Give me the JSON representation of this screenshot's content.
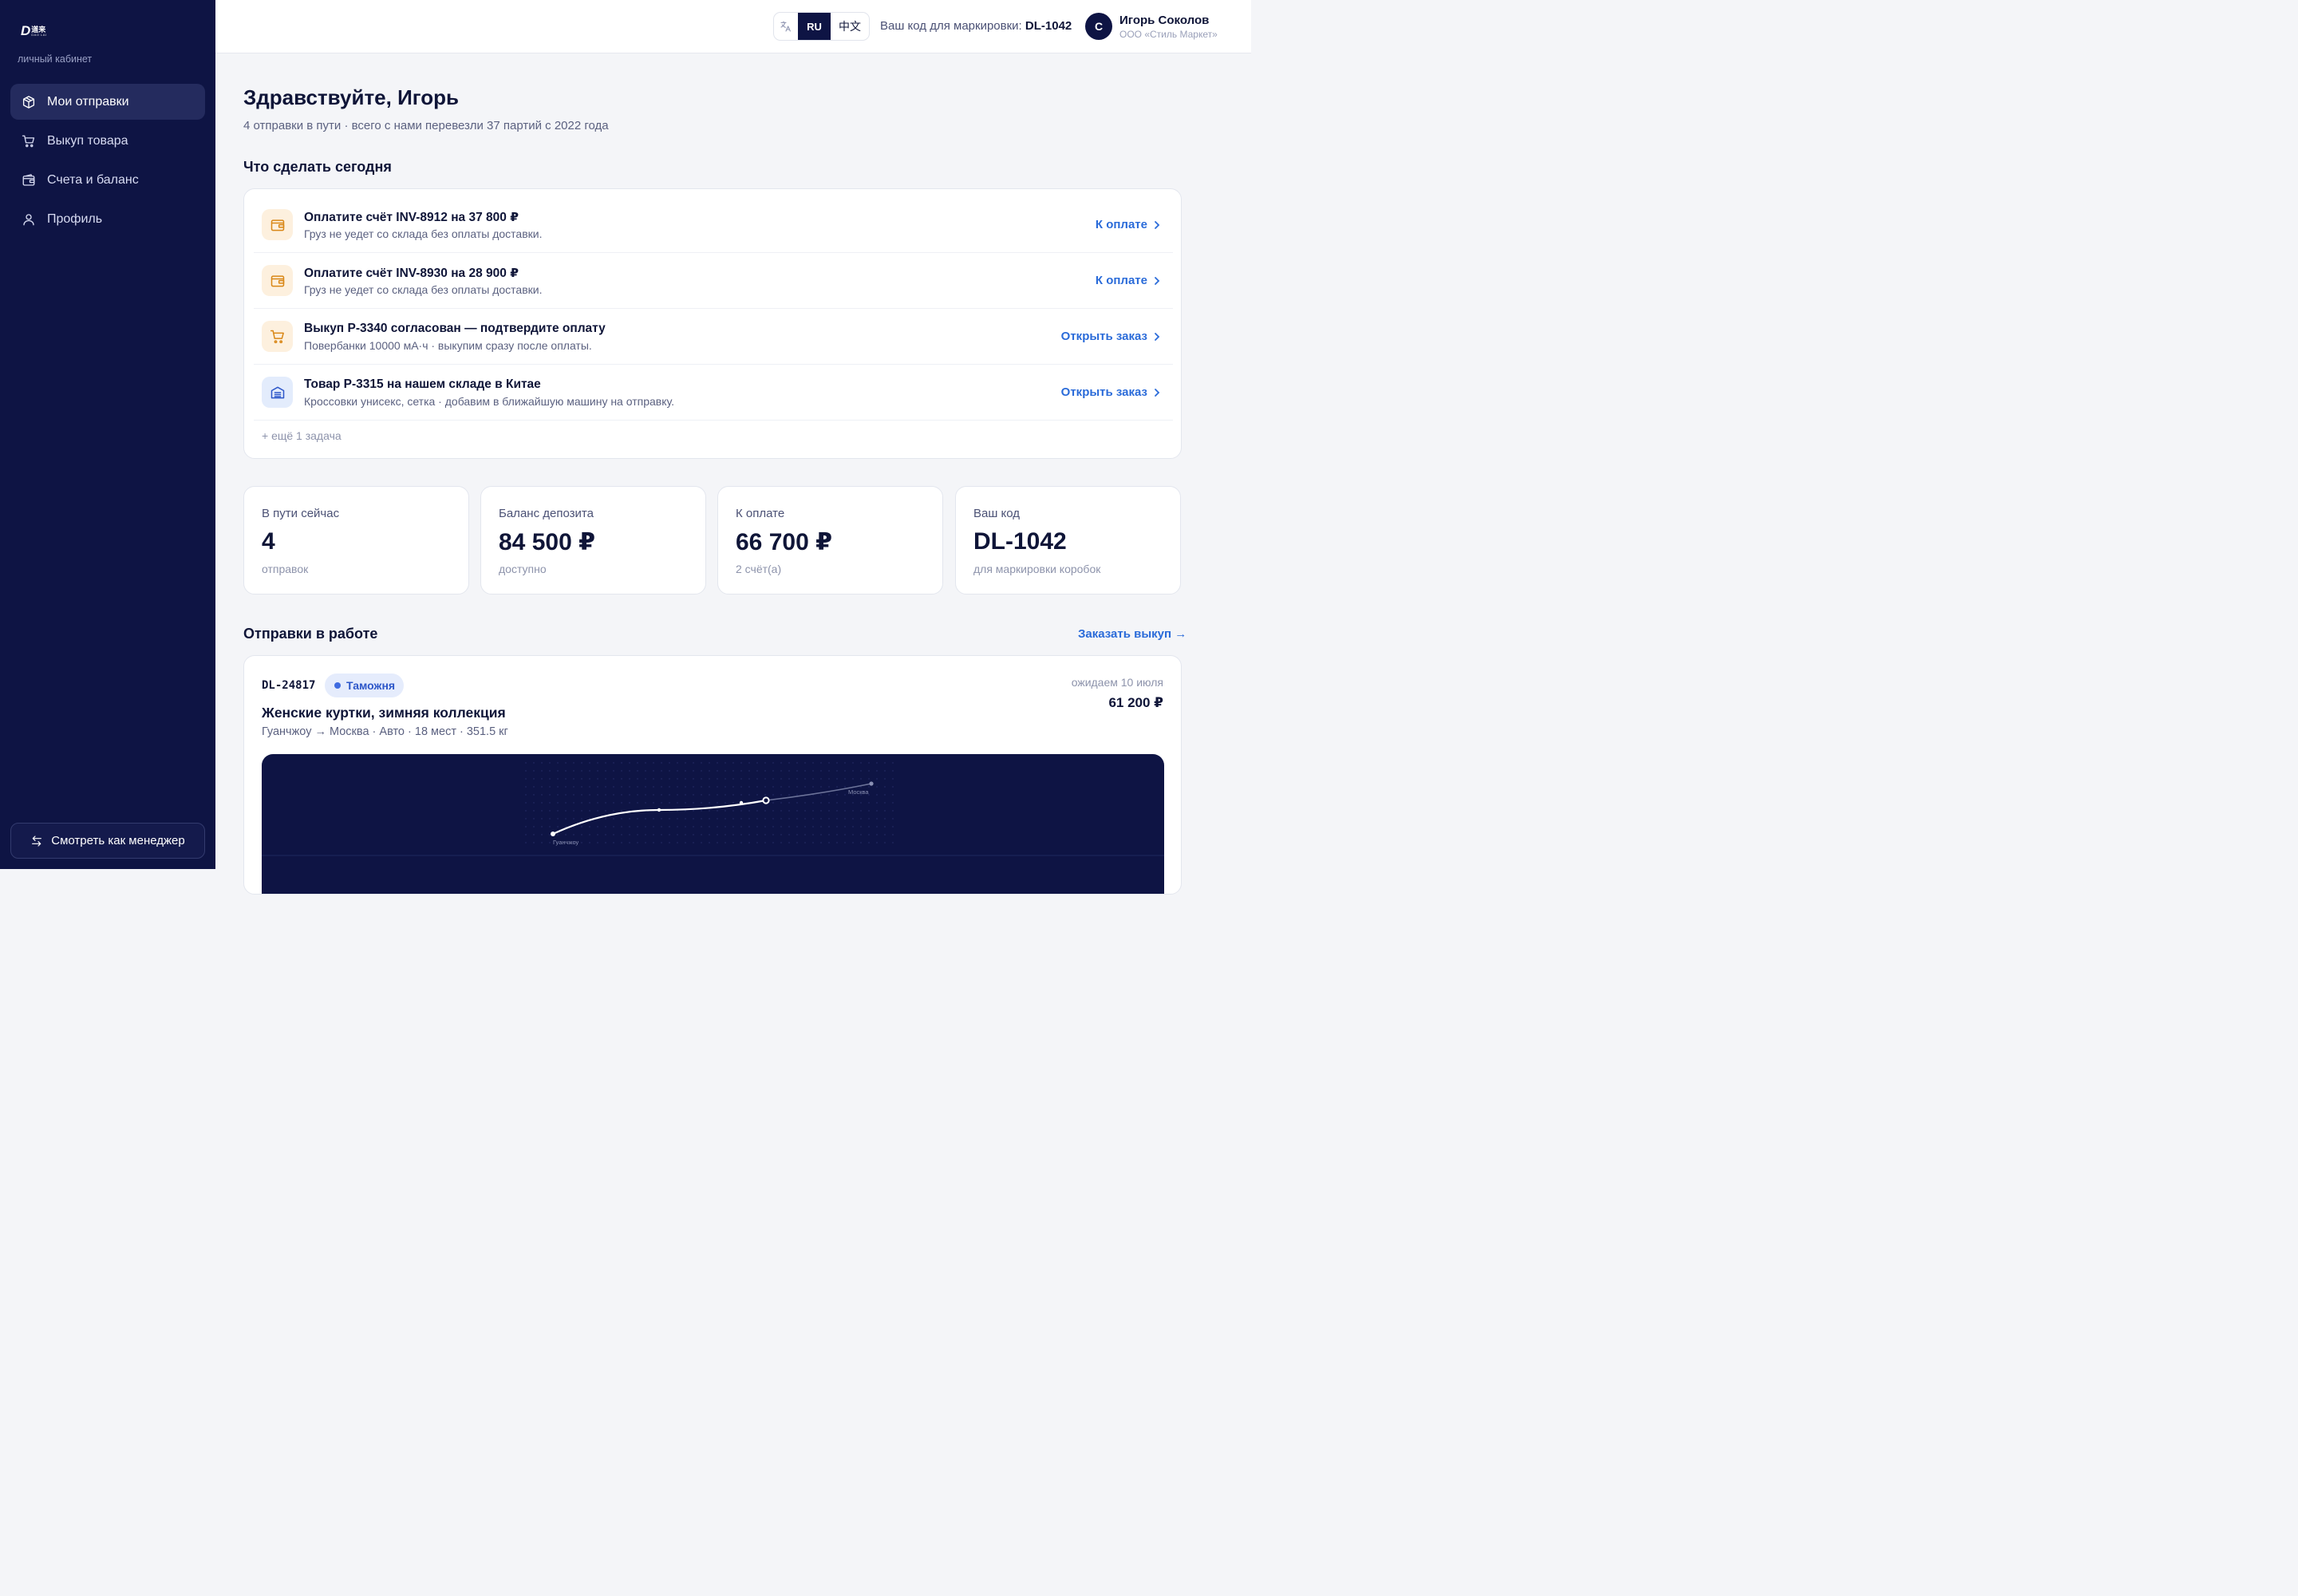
{
  "brand": {
    "logo_mark": "D",
    "logo_cn": "道来",
    "logo_en": "DAO LAI",
    "cabinet_label": "личный кабинет"
  },
  "nav": {
    "items": [
      {
        "label": "Мои отправки",
        "icon": "package-icon",
        "active": true
      },
      {
        "label": "Выкуп товара",
        "icon": "cart-icon",
        "active": false
      },
      {
        "label": "Счета и баланс",
        "icon": "wallet-icon",
        "active": false
      },
      {
        "label": "Профиль",
        "icon": "user-icon",
        "active": false
      }
    ],
    "manager_button": "Смотреть как менеджер"
  },
  "header": {
    "lang_options": [
      "RU",
      "中文"
    ],
    "lang_selected": "RU",
    "code_label": "Ваш код для маркировки:",
    "code_value": "DL-1042",
    "avatar_initial": "С",
    "user_name": "Игорь Соколов",
    "user_company": "ООО «Стиль Маркет»"
  },
  "greeting": {
    "title": "Здравствуйте, Игорь",
    "subtitle": "4 отправки в пути · всего с нами перевезли 37 партий с 2022 года"
  },
  "tasks": {
    "section_title": "Что сделать сегодня",
    "items": [
      {
        "icon": "wallet-icon",
        "title": "Оплатите счёт INV-8912 на 37 800 ₽",
        "subtitle": "Груз не уедет со склада без оплаты доставки.",
        "action": "К оплате"
      },
      {
        "icon": "wallet-icon",
        "title": "Оплатите счёт INV-8930 на 28 900 ₽",
        "subtitle": "Груз не уедет со склада без оплаты доставки.",
        "action": "К оплате"
      },
      {
        "icon": "cart-icon",
        "title": "Выкуп P-3340 согласован — подтвердите оплату",
        "subtitle": "Повербанки 10000 мА·ч · выкупим сразу после оплаты.",
        "action": "Открыть заказ"
      },
      {
        "icon": "warehouse-icon",
        "title": "Товар P-3315 на нашем складе в Китае",
        "subtitle": "Кроссовки унисекс, сетка · добавим в ближайшую машину на отправку.",
        "action": "Открыть заказ"
      }
    ],
    "more": "+ ещё 1 задача"
  },
  "stats": [
    {
      "label": "В пути сейчас",
      "value": "4",
      "sub": "отправок"
    },
    {
      "label": "Баланс депозита",
      "value": "84 500 ₽",
      "sub": "доступно"
    },
    {
      "label": "К оплате",
      "value": "66 700 ₽",
      "sub": "2 счёт(а)"
    },
    {
      "label": "Ваш код",
      "value": "DL-1042",
      "sub": "для маркировки коробок"
    }
  ],
  "shipments": {
    "section_title": "Отправки в работе",
    "order_link": "Заказать выкуп →",
    "items": [
      {
        "id": "DL-24817",
        "status": "Таможня",
        "expected": "ожидаем 10 июля",
        "price": "61 200 ₽",
        "title": "Женские куртки, зимняя коллекция",
        "meta": "Гуанчжоу → Москва · Авто · 18 мест · 351.5 кг",
        "route_from": "Гуанчжоу",
        "route_to": "Москва"
      }
    ]
  },
  "colors": {
    "sidebar_bg": "#0e1444",
    "accent_link": "#2a6bd9",
    "task_orange": "#d98716",
    "task_blue": "#2d57c9"
  }
}
